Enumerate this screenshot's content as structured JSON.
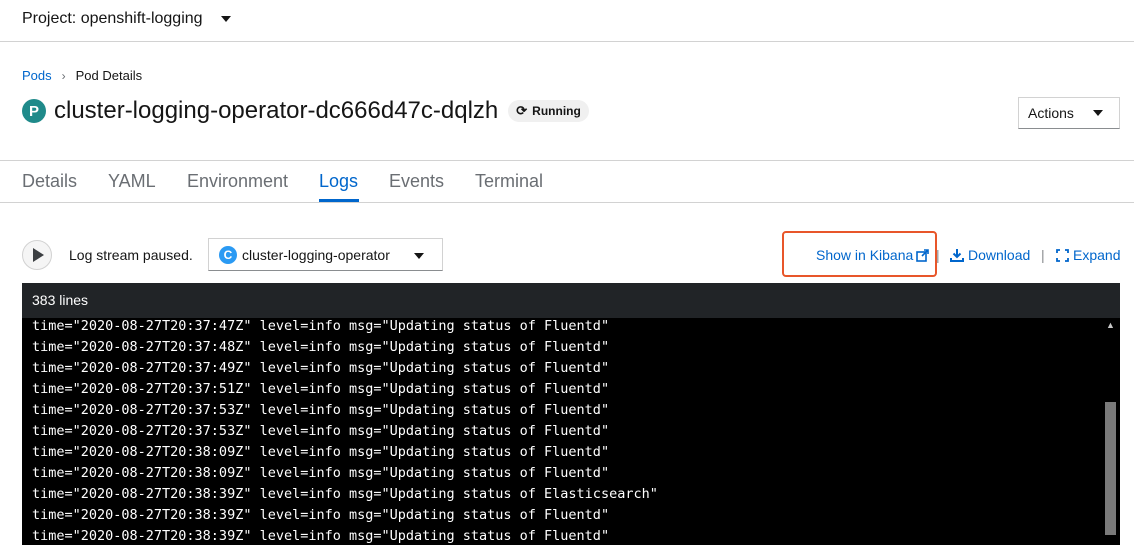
{
  "project": {
    "label": "Project: openshift-logging"
  },
  "breadcrumb": {
    "parent": "Pods",
    "current": "Pod Details"
  },
  "resource": {
    "badge": "P",
    "name": "cluster-logging-operator-dc666d47c-dqlzh",
    "status": "Running"
  },
  "actions": {
    "label": "Actions"
  },
  "tabs": [
    {
      "label": "Details"
    },
    {
      "label": "YAML"
    },
    {
      "label": "Environment"
    },
    {
      "label": "Logs"
    },
    {
      "label": "Events"
    },
    {
      "label": "Terminal"
    }
  ],
  "logs": {
    "stream_status": "Log stream paused.",
    "container": {
      "badge": "C",
      "name": "cluster-logging-operator"
    },
    "show_in_kibana": "Show in Kibana",
    "download": "Download",
    "expand": "Expand",
    "separator": "|",
    "line_count": "383 lines",
    "lines": [
      "time=\"2020-08-27T20:37:47Z\" level=info msg=\"Updating status of Fluentd\"",
      "time=\"2020-08-27T20:37:48Z\" level=info msg=\"Updating status of Fluentd\"",
      "time=\"2020-08-27T20:37:49Z\" level=info msg=\"Updating status of Fluentd\"",
      "time=\"2020-08-27T20:37:51Z\" level=info msg=\"Updating status of Fluentd\"",
      "time=\"2020-08-27T20:37:53Z\" level=info msg=\"Updating status of Fluentd\"",
      "time=\"2020-08-27T20:37:53Z\" level=info msg=\"Updating status of Fluentd\"",
      "time=\"2020-08-27T20:38:09Z\" level=info msg=\"Updating status of Fluentd\"",
      "time=\"2020-08-27T20:38:09Z\" level=info msg=\"Updating status of Fluentd\"",
      "time=\"2020-08-27T20:38:39Z\" level=info msg=\"Updating status of Elasticsearch\"",
      "time=\"2020-08-27T20:38:39Z\" level=info msg=\"Updating status of Fluentd\"",
      "time=\"2020-08-27T20:38:39Z\" level=info msg=\"Updating status of Fluentd\""
    ]
  },
  "colors": {
    "link": "#0066cc",
    "highlight": "#e8562a",
    "log_bg": "#000000",
    "log_header_bg": "#212427"
  }
}
